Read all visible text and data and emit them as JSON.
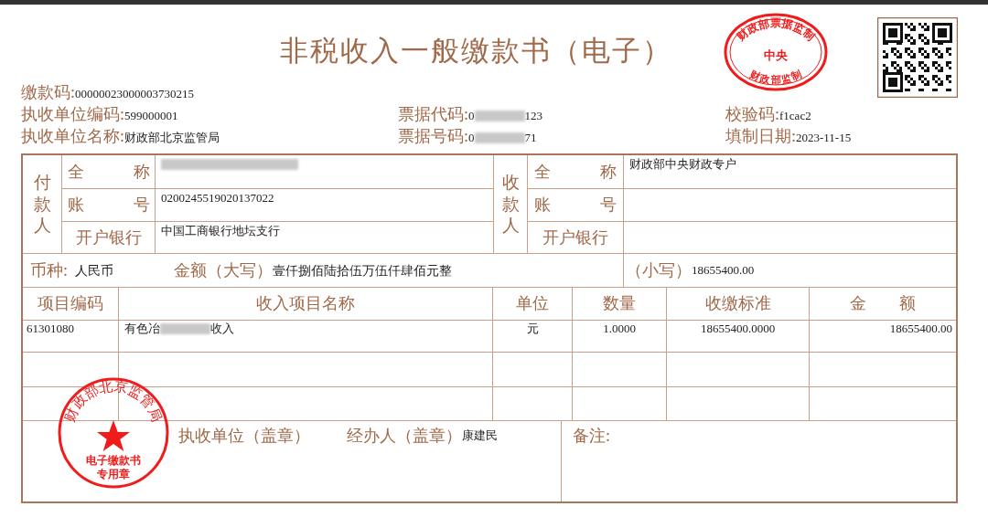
{
  "title": "非税收入一般缴款书（电子）",
  "header_rows": [
    [
      {
        "label": "缴款码:",
        "value": [
          {
            "kind": "text",
            "text": "00000023000003730215"
          }
        ]
      }
    ],
    [
      {
        "label": "执收单位编码:",
        "value": [
          {
            "kind": "text",
            "text": "599000001"
          }
        ]
      },
      {
        "label": "票据代码:",
        "value": [
          {
            "kind": "text",
            "text": "0"
          },
          {
            "kind": "redacted"
          },
          {
            "kind": "text",
            "text": "123"
          }
        ]
      },
      {
        "label": "校验码:",
        "value": [
          {
            "kind": "text",
            "text": "f1cac2"
          }
        ]
      }
    ],
    [
      {
        "label": "执收单位名称:",
        "value": [
          {
            "kind": "text",
            "text": "财政部北京监管局"
          }
        ]
      },
      {
        "label": "票据号码:",
        "value": [
          {
            "kind": "text",
            "text": "0"
          },
          {
            "kind": "redacted"
          },
          {
            "kind": "text",
            "text": "71"
          }
        ]
      },
      {
        "label": "填制日期:",
        "value": [
          {
            "kind": "text",
            "text": "2023-11-15"
          }
        ]
      }
    ]
  ],
  "parties": [
    {
      "heading": "付款人",
      "rows": [
        {
          "label": "全　　　称",
          "value": [
            {
              "kind": "redacted"
            }
          ]
        },
        {
          "label": "账　　　号",
          "value": [
            {
              "kind": "text",
              "text": "0200245519020137022"
            }
          ]
        },
        {
          "label": "开户银行",
          "value": [
            {
              "kind": "text",
              "text": "中国工商银行地坛支行"
            }
          ]
        }
      ]
    },
    {
      "heading": "收款人",
      "rows": [
        {
          "label": "全　　　称",
          "value": [
            {
              "kind": "text",
              "text": "财政部中央财政专户"
            }
          ]
        },
        {
          "label": "账　　　号",
          "value": []
        },
        {
          "label": "开户银行",
          "value": []
        }
      ]
    }
  ],
  "currency": {
    "label": "币种:",
    "value": "人民币"
  },
  "amount_words": {
    "label": "金额（大写）",
    "value": "壹仟捌佰陆拾伍万伍仟肆佰元整"
  },
  "amount_figures": {
    "label": "（小写）",
    "value": "18655400.00"
  },
  "items": {
    "columns": [
      "项目编码",
      "收入项目名称",
      "单位",
      "数量",
      "收缴标准",
      "金　　额"
    ],
    "rows": [
      [
        [
          {
            "kind": "text",
            "text": "61301080"
          }
        ],
        [
          {
            "kind": "text",
            "text": "有色冶"
          },
          {
            "kind": "redacted"
          },
          {
            "kind": "text",
            "text": "收入"
          }
        ],
        [
          {
            "kind": "text",
            "text": "元"
          }
        ],
        [
          {
            "kind": "text",
            "text": "1.0000"
          }
        ],
        [
          {
            "kind": "text",
            "text": "18655400.0000"
          }
        ],
        [
          {
            "kind": "text",
            "text": "18655400.00"
          }
        ]
      ]
    ]
  },
  "collector": {
    "label": "执收单位（盖章）"
  },
  "handler": {
    "label": "经办人（盖章）",
    "value": "康建民"
  },
  "remarks": {
    "label": "备注:"
  },
  "stamps": [
    {
      "kind": "oval",
      "lines": [
        "财政部票据监制",
        "中央",
        "财政部监制"
      ]
    },
    {
      "kind": "round",
      "lines": [
        "财政部北京监管局",
        "电子缴款书",
        "专用章"
      ]
    }
  ]
}
